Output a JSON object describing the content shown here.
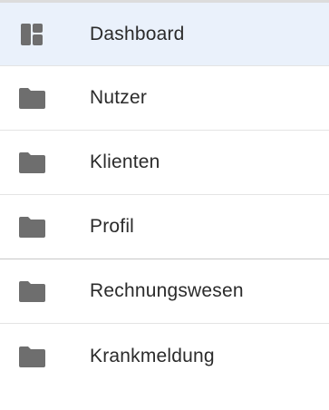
{
  "sidebar": {
    "items": [
      {
        "label": "Dashboard",
        "icon": "dashboard-icon",
        "active": true
      },
      {
        "label": "Nutzer",
        "icon": "folder-icon",
        "active": false
      },
      {
        "label": "Klienten",
        "icon": "folder-icon",
        "active": false
      },
      {
        "label": "Profil",
        "icon": "folder-icon",
        "active": false
      },
      {
        "label": "Rechnungswesen",
        "icon": "folder-icon",
        "active": false
      },
      {
        "label": "Krankmeldung",
        "icon": "folder-icon",
        "active": false
      }
    ],
    "colors": {
      "active_background": "#eaf1fb",
      "icon": "#6e6e6e",
      "text": "#2b2b2b"
    }
  }
}
